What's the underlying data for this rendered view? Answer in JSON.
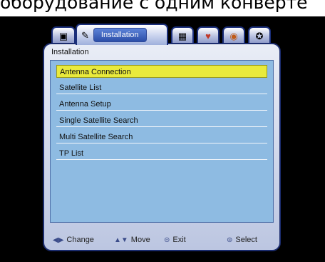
{
  "caption": "оборудование с одним конверте",
  "tabs": [
    {
      "icon": "dish-icon",
      "glyph": "▣"
    },
    {
      "icon": "tools-icon",
      "glyph": "✎",
      "label": "Installation",
      "active": true
    },
    {
      "icon": "channels-icon",
      "glyph": "▦"
    },
    {
      "icon": "heart-icon",
      "glyph": "♥"
    },
    {
      "icon": "media-icon",
      "glyph": "◉"
    },
    {
      "icon": "settings-icon",
      "glyph": "✪"
    }
  ],
  "panel_title": "Installation",
  "menu": {
    "selected_index": 0,
    "items": [
      "Antenna Connection",
      "Satellite List",
      "Antenna Setup",
      "Single Satellite Search",
      "Multi Satellite Search",
      "TP List"
    ]
  },
  "footer": {
    "change": {
      "icon": "left-right-arrows-icon",
      "glyph": "◀▶",
      "label": "Change"
    },
    "move": {
      "icon": "up-down-arrows-icon",
      "glyph": "▲▼",
      "label": "Move"
    },
    "exit": {
      "icon": "exit-button-icon",
      "glyph": "⊝",
      "label": "Exit"
    },
    "select": {
      "icon": "ok-button-icon",
      "glyph": "⊜",
      "label": "Select"
    }
  },
  "colors": {
    "selection": "#e9ea3c",
    "list_background": "#8ebbe2",
    "frame_border": "#1b2c6e"
  }
}
